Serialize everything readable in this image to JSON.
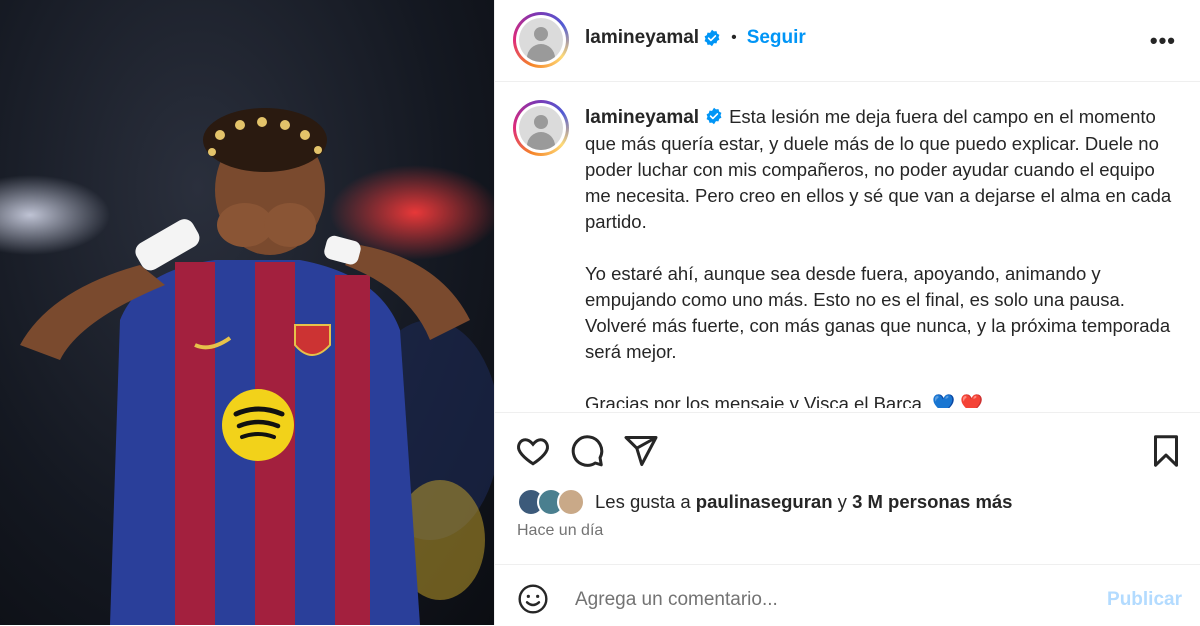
{
  "header": {
    "username": "lamineyamal",
    "separator": "•",
    "follow_label": "Seguir",
    "more_label": "•••"
  },
  "caption": {
    "username": "lamineyamal",
    "paragraphs": [
      "Esta lesión me deja fuera del campo en el momento que más quería estar, y duele más de lo que puedo explicar. Duele no poder luchar con mis compañeros, no poder ayudar cuando el equipo me necesita. Pero creo en ellos y sé que van a dejarse el alma en cada partido.",
      "Yo estaré ahí, aunque sea desde fuera, apoyando, animando y empujando como uno más. Esto no es el final, es solo una pausa. Volveré más fuerte, con más ganas que nunca, y la próxima temporada será mejor.",
      "Gracias por los mensaje y Visca el Barça. 💙 ❤️"
    ]
  },
  "likes": {
    "prefix": "Les gusta a",
    "user": "paulinaseguran",
    "middle": "y",
    "count": "3 M personas más"
  },
  "time_ago": "Hace un día",
  "comment": {
    "placeholder": "Agrega un comentario...",
    "publish_label": "Publicar"
  },
  "colors": {
    "accent": "#0095f6",
    "publish_disabled": "#b3dbff",
    "verified": "#0095f6",
    "kit_blue": "#2a3f9a",
    "kit_red": "#a3203e"
  }
}
